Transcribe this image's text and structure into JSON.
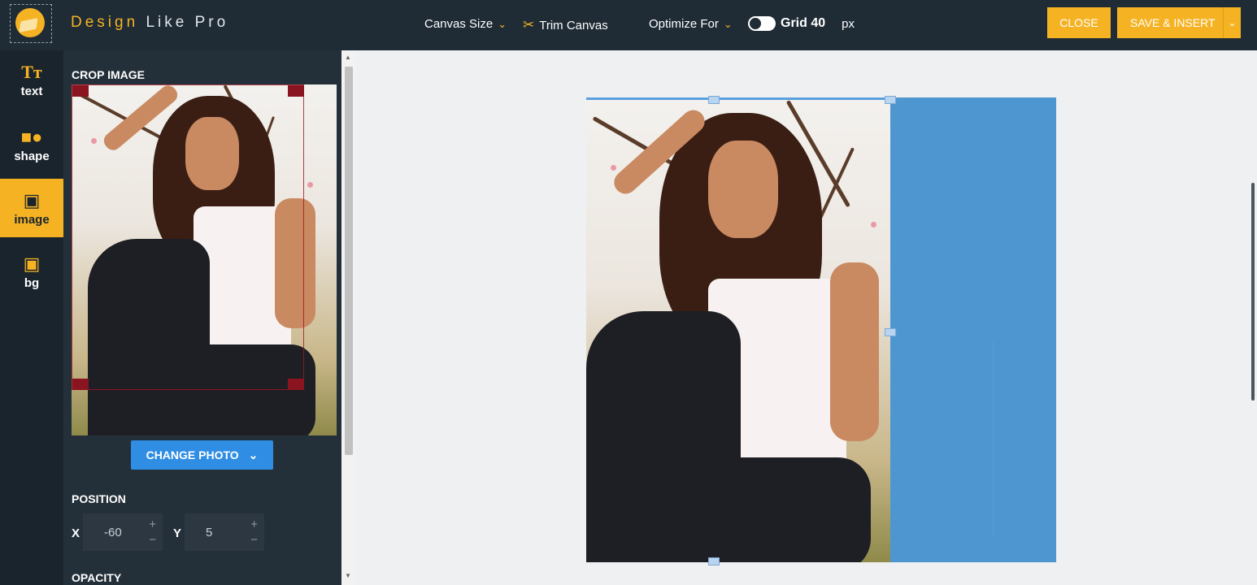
{
  "app": {
    "brand_part1": "Design",
    "brand_part2": "Like",
    "brand_part3": "Pro",
    "logo_icon": "paint-drop-logo"
  },
  "toolbar": {
    "canvas_size": "Canvas Size",
    "trim_canvas": "Trim Canvas",
    "optimize_for": "Optimize For",
    "grid_label": "Grid 40",
    "grid_unit": "px",
    "grid_enabled": true,
    "close": "CLOSE",
    "save_insert": "SAVE & INSERT"
  },
  "rail": {
    "items": [
      {
        "label": "text",
        "icon": "text-icon"
      },
      {
        "label": "shape",
        "icon": "shapes-icon"
      },
      {
        "label": "image",
        "icon": "image-icon",
        "active": true
      },
      {
        "label": "bg",
        "icon": "background-icon"
      }
    ]
  },
  "panel": {
    "crop_title": "CROP IMAGE",
    "change_photo": "CHANGE PHOTO",
    "position_title": "POSITION",
    "x_label": "X",
    "x_value": "-60",
    "y_label": "Y",
    "y_value": "5",
    "opacity_title": "OPACITY"
  },
  "colors": {
    "topbar": "#1f2b35",
    "accent": "#f5b324",
    "primary_button": "#2f8de4",
    "artboard": "#4e96d0"
  }
}
